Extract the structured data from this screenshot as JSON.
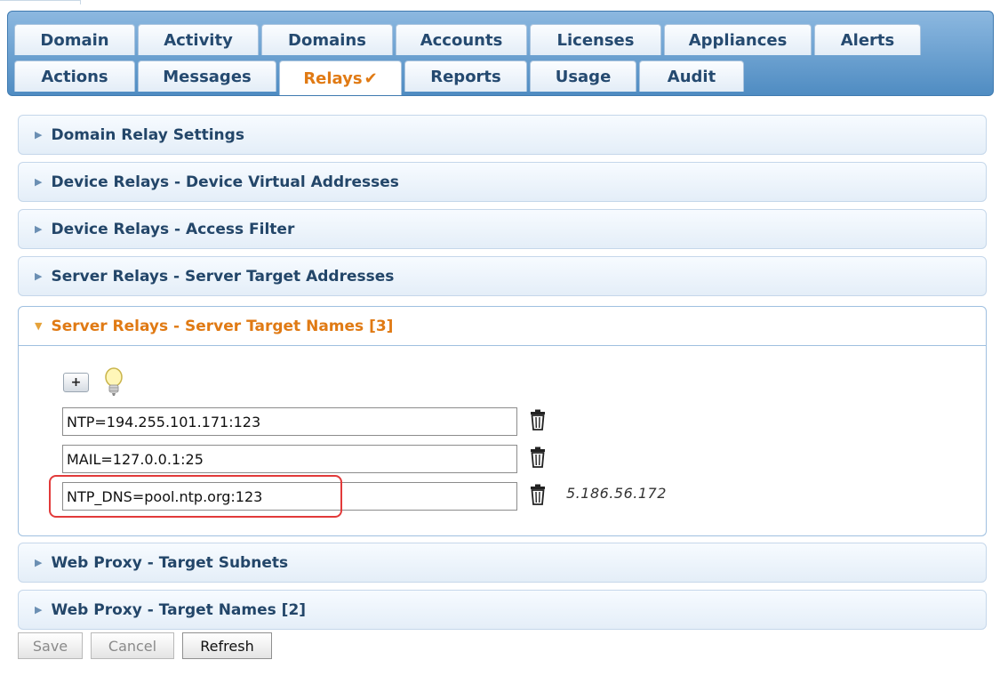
{
  "tabs": {
    "row1": [
      {
        "label": "Domain"
      },
      {
        "label": "Activity"
      },
      {
        "label": "Domains"
      },
      {
        "label": "Accounts"
      },
      {
        "label": "Licenses"
      },
      {
        "label": "Appliances"
      },
      {
        "label": "Alerts"
      }
    ],
    "row2": [
      {
        "label": "Actions"
      },
      {
        "label": "Messages"
      },
      {
        "label": "Relays",
        "active": true,
        "check": "✔"
      },
      {
        "label": "Reports"
      },
      {
        "label": "Usage"
      },
      {
        "label": "Audit"
      }
    ]
  },
  "sections": [
    {
      "label": "Domain Relay Settings",
      "state": "collapsed"
    },
    {
      "label": "Device Relays - Device Virtual Addresses",
      "state": "collapsed"
    },
    {
      "label": "Device Relays - Access Filter",
      "state": "collapsed"
    },
    {
      "label": "Server Relays - Server Target Addresses",
      "state": "collapsed"
    },
    {
      "label": "Server Relays - Server Target Names [3]",
      "state": "expanded"
    },
    {
      "label": "Web Proxy - Target Subnets",
      "state": "collapsed"
    },
    {
      "label": "Web Proxy - Target Names [2]",
      "state": "collapsed"
    }
  ],
  "target_names": {
    "add_label": "+",
    "entries": [
      {
        "value": "NTP=194.255.101.171:123",
        "resolved": ""
      },
      {
        "value": "MAIL=127.0.0.1:25",
        "resolved": ""
      },
      {
        "value": "NTP_DNS=pool.ntp.org:123",
        "resolved": "5.186.56.172",
        "highlighted": true
      }
    ]
  },
  "actions": {
    "save_label": "Save",
    "cancel_label": "Cancel",
    "refresh_label": "Refresh"
  },
  "colors": {
    "tabbar": "#5f99cb",
    "active_tab_text": "#e07a14",
    "highlight": "#e23a3a"
  }
}
